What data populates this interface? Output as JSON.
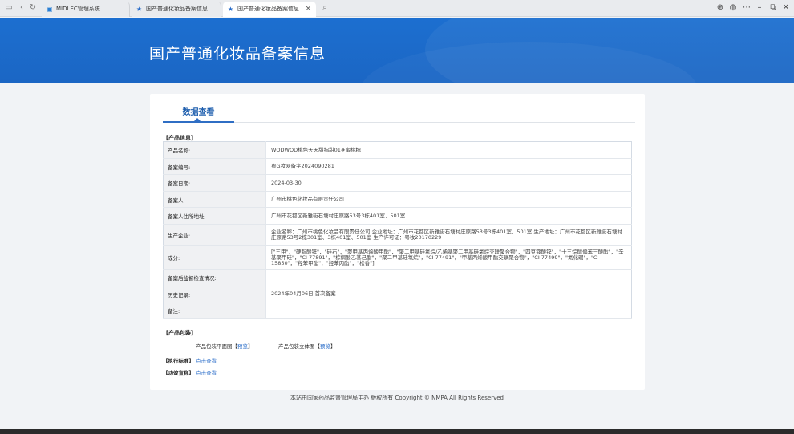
{
  "browser": {
    "tabs": [
      {
        "label": "MIDLEC管理系统"
      },
      {
        "label": "国产普通化妆品备案信息"
      },
      {
        "label": "国产普通化妆品备案信息"
      }
    ],
    "close_glyph": "×"
  },
  "banner": {
    "title": "国产普通化妆品备案信息"
  },
  "card": {
    "tab_label": "数据查看",
    "product_info_label": "【产品信息】",
    "rows": [
      {
        "key": "产品名称:",
        "value": "WODWOD桃色天天甜指甜01#蜜桃糯"
      },
      {
        "key": "备案编号:",
        "value": "粤G妆网备字2024090281"
      },
      {
        "key": "备案日期:",
        "value": "2024-03-30"
      },
      {
        "key": "备案人:",
        "value": "广州市桃色化妆品有限责任公司"
      },
      {
        "key": "备案人住所地址:",
        "value": "广州市花都区新雅街石塘村庄原路53号3栋401室、501室"
      },
      {
        "key": "生产企业:",
        "value": "企业名称：广州市桃色化妆品有限责任公司 企业地址：广州市花都区新雅街石塘村庄原路53号3栋401室、501室 生产地址：广州市花都区新雅街石塘村庄原路53号2栋301室、3栋401室、501室 生产许可证：粤妆20170229"
      },
      {
        "key": "成分:",
        "value": "[\"三甲\"，\"硬脂酸锌\"，\"硅石\"，\"聚甲基丙烯酸甲酯\"，\"聚二甲基硅氧烷/乙烯基聚二甲基硅氧烷交联聚合物\"，\"四豆蔻酸锌\"，\"十三烷醇偏苯三酸酯\"，\"辛基聚甲硅\"，\"CI 77891\"，\"棕榈酸乙基己酯\"，\"聚二甲基硅氧烷\"，\"CI 77491\"，\"甲基丙烯酸甲酯交联聚合物\"，\"CI 77499\"，\"氮化硼\"，\"CI 15850\"，\"羟苯甲酯\"，\"羟苯丙酯\"，\"松香\"]"
      },
      {
        "key": "备案后监督检查情况:",
        "value": ""
      },
      {
        "key": "历史记录:",
        "value": "2024年04月06日 首次备案"
      },
      {
        "key": "备注:",
        "value": ""
      }
    ],
    "package_label": "【产品包装】",
    "pkg_flat_text": "产品包装平面图【",
    "pkg_flat_link": "预览",
    "pkg_flat_close": "】",
    "pkg_3d_text": "产品包装立体图【",
    "pkg_3d_link": "预览",
    "pkg_3d_close": "】",
    "standard_label": "【执行标准】",
    "standard_link": "点击查看",
    "efficacy_label": "【功效宣称】",
    "efficacy_link": "点击查看"
  },
  "footer": {
    "text": "本站由国家药品监督管理局主办 版权所有 Copyright © NMPA All Rights Reserved"
  }
}
